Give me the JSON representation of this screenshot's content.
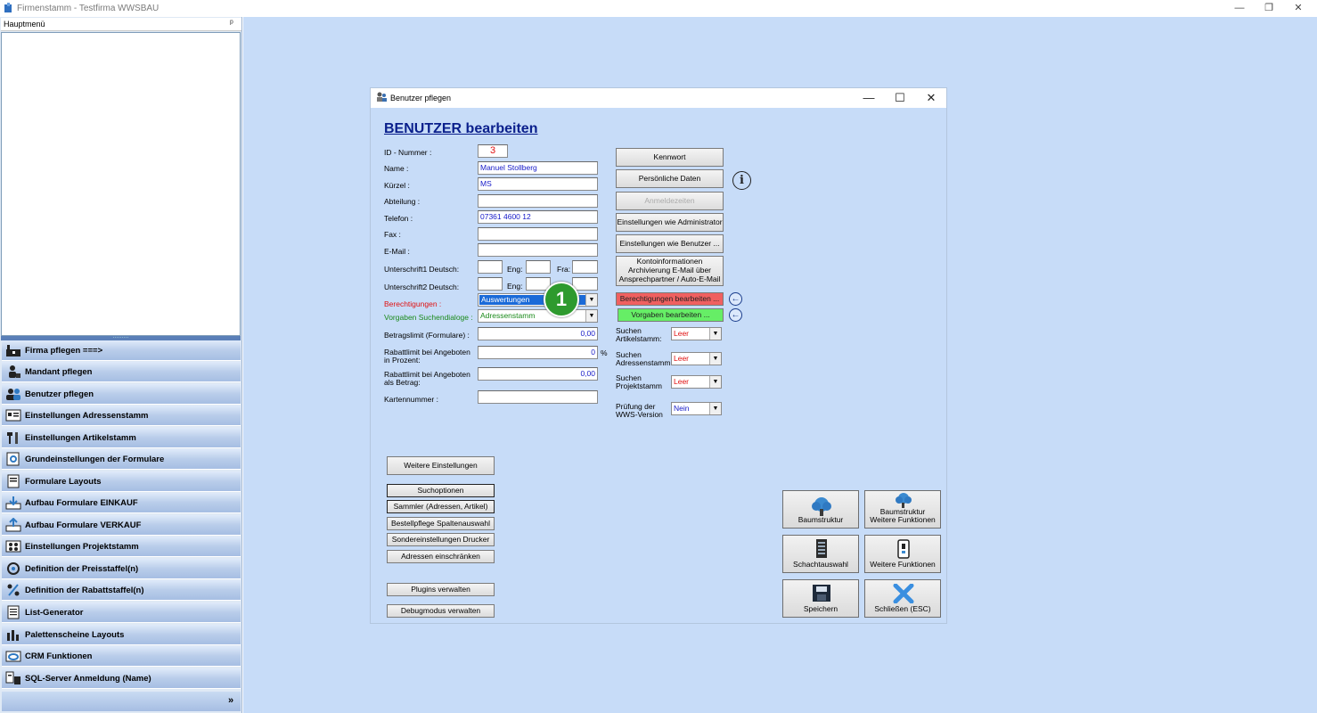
{
  "window": {
    "title": "Firmenstamm - Testfirma WWSBAU",
    "minimize": "—",
    "restore": "❐",
    "close": "✕"
  },
  "sidebar": {
    "header": "Hauptmenü",
    "items": [
      {
        "label": "Firma pflegen   ===>",
        "icon": "factory-icon"
      },
      {
        "label": "Mandant pflegen",
        "icon": "user-tree-icon"
      },
      {
        "label": "Benutzer pflegen",
        "icon": "users-icon"
      },
      {
        "label": "Einstellungen Adressenstamm",
        "icon": "address-card-icon"
      },
      {
        "label": "Einstellungen Artikelstamm",
        "icon": "tools-icon"
      },
      {
        "label": "Grundeinstellungen der Formulare",
        "icon": "form-settings-icon"
      },
      {
        "label": "Formulare Layouts",
        "icon": "document-layout-icon"
      },
      {
        "label": "Aufbau Formulare EINKAUF",
        "icon": "inbox-download-icon"
      },
      {
        "label": "Aufbau Formulare VERKAUF",
        "icon": "inbox-upload-icon"
      },
      {
        "label": "Einstellungen Projektstamm",
        "icon": "project-grid-icon"
      },
      {
        "label": "Definition der Preisstaffel(n)",
        "icon": "price-settings-icon"
      },
      {
        "label": "Definition der Rabattstaffel(n)",
        "icon": "discount-icon"
      },
      {
        "label": "List-Generator",
        "icon": "list-icon"
      },
      {
        "label": "Palettenscheine Layouts",
        "icon": "pallet-chart-icon"
      },
      {
        "label": "CRM Funktionen",
        "icon": "crm-icon"
      },
      {
        "label": "SQL-Server Anmeldung (Name)",
        "icon": "server-login-icon"
      }
    ],
    "footer_chevron": "»"
  },
  "dialog": {
    "title": "Benutzer pflegen",
    "heading": "BENUTZER bearbeiten",
    "fields": {
      "id_label": "ID - Nummer :",
      "id_value": "3",
      "name_label": "Name :",
      "name_value": "Manuel Stollberg",
      "kuerzel_label": "Kürzel :",
      "kuerzel_value": "MS",
      "abteilung_label": "Abteilung :",
      "abteilung_value": "",
      "telefon_label": "Telefon :",
      "telefon_value": "07361 4600 12",
      "fax_label": "Fax :",
      "fax_value": "",
      "email_label": "E-Mail :",
      "email_value": "",
      "unterschrift1_label": "Unterschrift1 Deutsch:",
      "unterschrift2_label": "Unterschrift2 Deutsch:",
      "eng_label": "Eng:",
      "fra_label": "Fra:",
      "berechtigungen_label": "Berechtigungen :",
      "berechtigungen_value": "Auswertungen",
      "vorgaben_label": "Vorgaben Suchendialoge :",
      "vorgaben_value": "Adressenstamm",
      "betragslimit_label": "Betragslimit (Formulare) :",
      "betragslimit_value": "0,00",
      "rabatt_prozent_label_1": "Rabattlimit bei Angeboten",
      "rabatt_prozent_label_2": "in Prozent:",
      "rabatt_prozent_value": "0",
      "percent_sign": "%",
      "rabatt_betrag_label_1": "Rabattlimit bei Angeboten",
      "rabatt_betrag_label_2": "als Betrag:",
      "rabatt_betrag_value": "0,00",
      "kartennummer_label": "Kartennummer :",
      "kartennummer_value": ""
    },
    "callout_number": "1",
    "right_buttons": {
      "kennwort": "Kennwort",
      "persoenliche_daten": "Persönliche Daten",
      "anmeldezeiten": "Anmeldezeiten",
      "einstellungen_admin": "Einstellungen wie Administrator",
      "einstellungen_benutzer": "Einstellungen wie Benutzer ...",
      "konto_1": "Kontoinformationen",
      "konto_2": "Archivierung E-Mail über",
      "konto_3": "Ansprechpartner / Auto-E-Mail",
      "berechtigungen_bearbeiten": "Berechtigungen bearbeiten ...",
      "vorgaben_bearbeiten": "Vorgaben bearbeiten ..."
    },
    "info_icon": "i",
    "search_settings": {
      "artikel_label_1": "Suchen",
      "artikel_label_2": "Artikelstamm:",
      "artikel_value": "Leer",
      "adressen_label_1": "Suchen",
      "adressen_label_2": "Adressenstamm:",
      "adressen_value": "Leer",
      "projekt_label_1": "Suchen",
      "projekt_label_2": "Projektstamm",
      "projekt_value": "Leer",
      "pruefung_label_1": "Prüfung der",
      "pruefung_label_2": "WWS-Version",
      "pruefung_value": "Nein"
    },
    "left_buttons": {
      "weitere_einstellungen": "Weitere Einstellungen",
      "suchoptionen": "Suchoptionen",
      "sammler": "Sammler (Adressen, Artikel)",
      "bestellpflege": "Bestellpflege Spaltenauswahl",
      "sondereinstellungen": "Sondereinstellungen Drucker",
      "adressen_einschraenken": "Adressen einschränken",
      "plugins": "Plugins verwalten",
      "debugmodus": "Debugmodus verwalten"
    },
    "big_buttons": {
      "baumstruktur": "Baumstruktur",
      "baumstruktur_weitere_1": "Baumstruktur",
      "baumstruktur_weitere_2": "Weitere Funktionen",
      "schachtauswahl": "Schachtauswahl",
      "weitere_funktionen": "Weitere Funktionen",
      "speichern": "Speichern",
      "schliessen": "Schließen (ESC)"
    },
    "colors": {
      "heading": "#0a1f8c",
      "red_label": "#e01010",
      "green_label": "#1a8a1a",
      "red_button": "#f06060",
      "green_button": "#66ee66",
      "callout": "#2e9a2e",
      "selection": "#1a6ad8"
    }
  }
}
